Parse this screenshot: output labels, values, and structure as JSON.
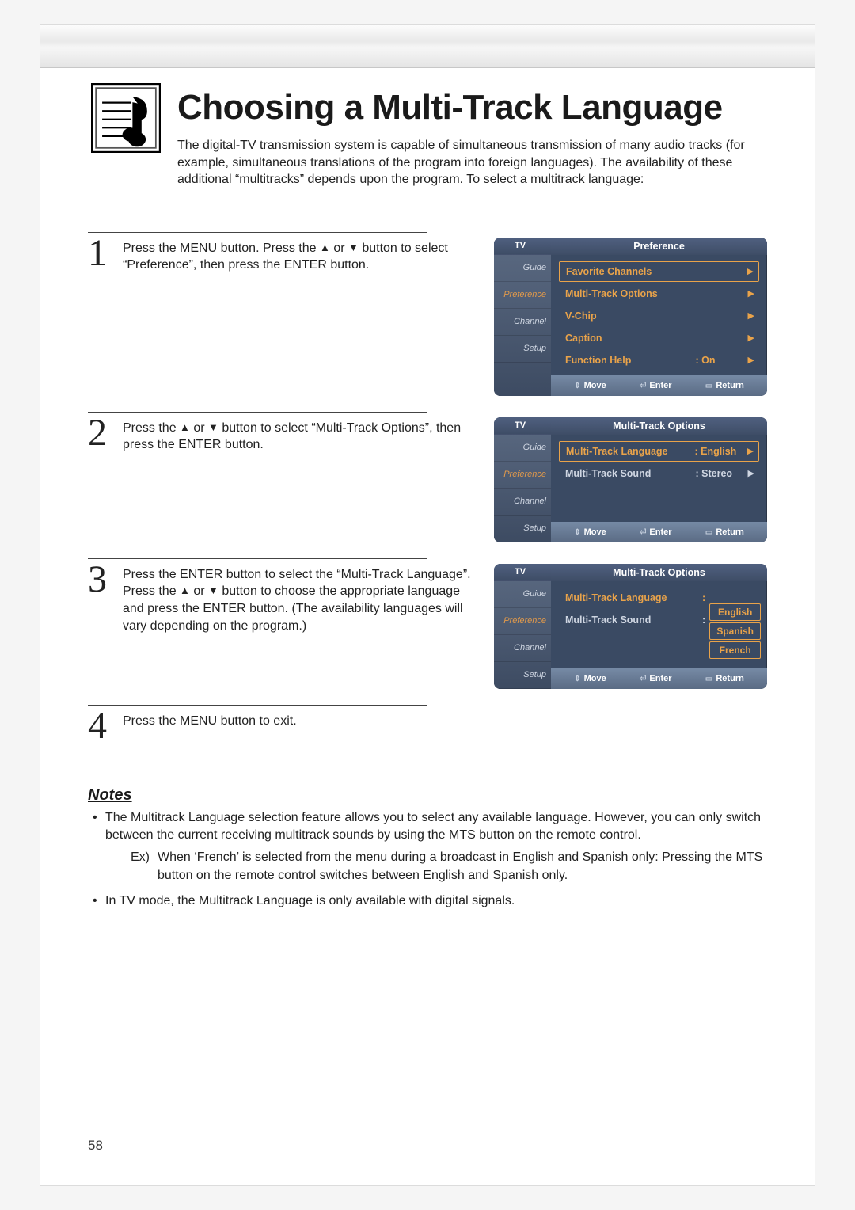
{
  "title": "Choosing a Multi-Track Language",
  "intro": "The digital-TV transmission system is capable of simultaneous transmission of many audio tracks (for example, simultaneous translations of the program into foreign languages). The availability of these additional “multitracks” depends upon the program. To select a multitrack language:",
  "page_number": "58",
  "steps": {
    "s1": {
      "num": "1",
      "text_a": "Press the MENU button. Press the ",
      "text_b": " or ",
      "text_c": " button to select “Preference”, then press the ENTER button."
    },
    "s2": {
      "num": "2",
      "text_a": "Press the ",
      "text_b": " or ",
      "text_c": " button to select “Multi-Track Options”, then press the ENTER button."
    },
    "s3": {
      "num": "3",
      "text_a": "Press the ENTER button to select the “Multi-Track Language”. Press the ",
      "text_b": " or ",
      "text_c": " button to choose the appropriate language and press the ENTER button. (The availability languages will vary depending on the program.)"
    },
    "s4": {
      "num": "4",
      "text": "Press the MENU button to exit."
    }
  },
  "osd": {
    "side": {
      "tv": "TV",
      "guide": "Guide",
      "preference": "Preference",
      "channel": "Channel",
      "setup": "Setup"
    },
    "foot": {
      "move": "Move",
      "enter": "Enter",
      "return": "Return"
    },
    "screen1": {
      "title": "Preference",
      "rows": [
        {
          "label": "Favorite Channels",
          "val": ""
        },
        {
          "label": "Multi-Track Options",
          "val": ""
        },
        {
          "label": "V-Chip",
          "val": ""
        },
        {
          "label": "Caption",
          "val": ""
        },
        {
          "label": "Function Help",
          "val": ": On"
        }
      ]
    },
    "screen2": {
      "title": "Multi-Track Options",
      "rows": [
        {
          "label": "Multi-Track Language",
          "val": ": English"
        },
        {
          "label": "Multi-Track Sound",
          "val": ": Stereo"
        }
      ]
    },
    "screen3": {
      "title": "Multi-Track Options",
      "rows": [
        {
          "label": "Multi-Track Language",
          "val": ":"
        },
        {
          "label": "Multi-Track Sound",
          "val": ":"
        }
      ],
      "lang_options": [
        "English",
        "Spanish",
        "French"
      ]
    }
  },
  "notes": {
    "heading": "Notes",
    "n1": "The Multitrack Language selection feature allows you to select any available language. However, you can only switch between the current receiving multitrack sounds by using the MTS button on the remote control.",
    "ex_label": "Ex)",
    "ex_text": "When ‘French’ is selected from the menu during a broadcast in English and Spanish only: Pressing the MTS button on the remote control switches between English and Spanish only.",
    "n2": "In TV mode, the Multitrack Language is only available with digital signals."
  }
}
